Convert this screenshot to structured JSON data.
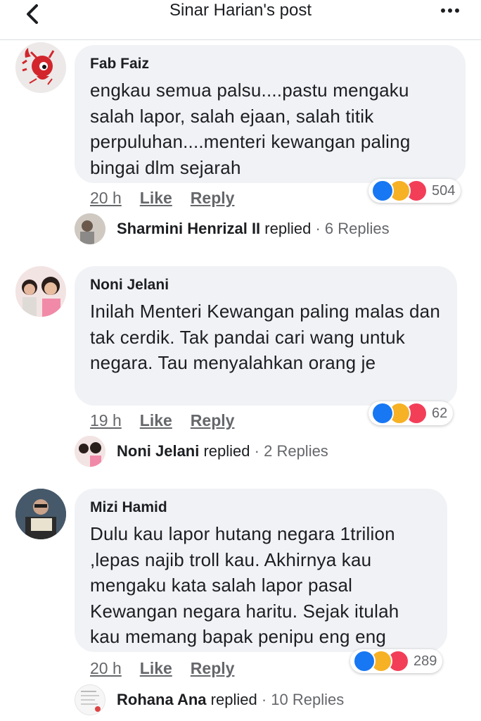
{
  "header": {
    "title": "Sinar Harian's post"
  },
  "comments": [
    {
      "author": "Fab Faiz",
      "text": "engkau semua palsu....pastu mengaku salah lapor, salah ejaan, salah titik perpuluhan....menteri kewangan paling bingai dlm sejarah",
      "time": "20 h",
      "like": "Like",
      "reply": "Reply",
      "reaction_count": "504",
      "replies_user": "Sharmini Henrizal II",
      "replies_verb": "replied",
      "replies_count": "· 6 Replies"
    },
    {
      "author": "Noni Jelani",
      "text": "Inilah Menteri Kewangan paling malas dan tak cerdik. Tak pandai cari wang untuk negara. Tau menyalahkan orang je",
      "time": "19 h",
      "like": "Like",
      "reply": "Reply",
      "reaction_count": "62",
      "replies_user": "Noni Jelani",
      "replies_verb": "replied",
      "replies_count": "· 2 Replies"
    },
    {
      "author": "Mizi Hamid",
      "text": "Dulu kau lapor hutang negara 1trilion ,lepas najib troll kau. Akhirnya  kau mengaku kata salah lapor pasal Kewangan negara haritu. Sejak itulah kau memang bapak penipu eng eng",
      "time": "20 h",
      "like": "Like",
      "reply": "Reply",
      "reaction_count": "289",
      "replies_user": "Rohana Ana",
      "replies_verb": "replied",
      "replies_count": "· 10 Replies"
    }
  ],
  "colors": {
    "like": "#1877f2",
    "haha": "#f7b125",
    "love": "#f33e58",
    "bubble": "#f0f2f5",
    "secondary_text": "#65676b"
  }
}
